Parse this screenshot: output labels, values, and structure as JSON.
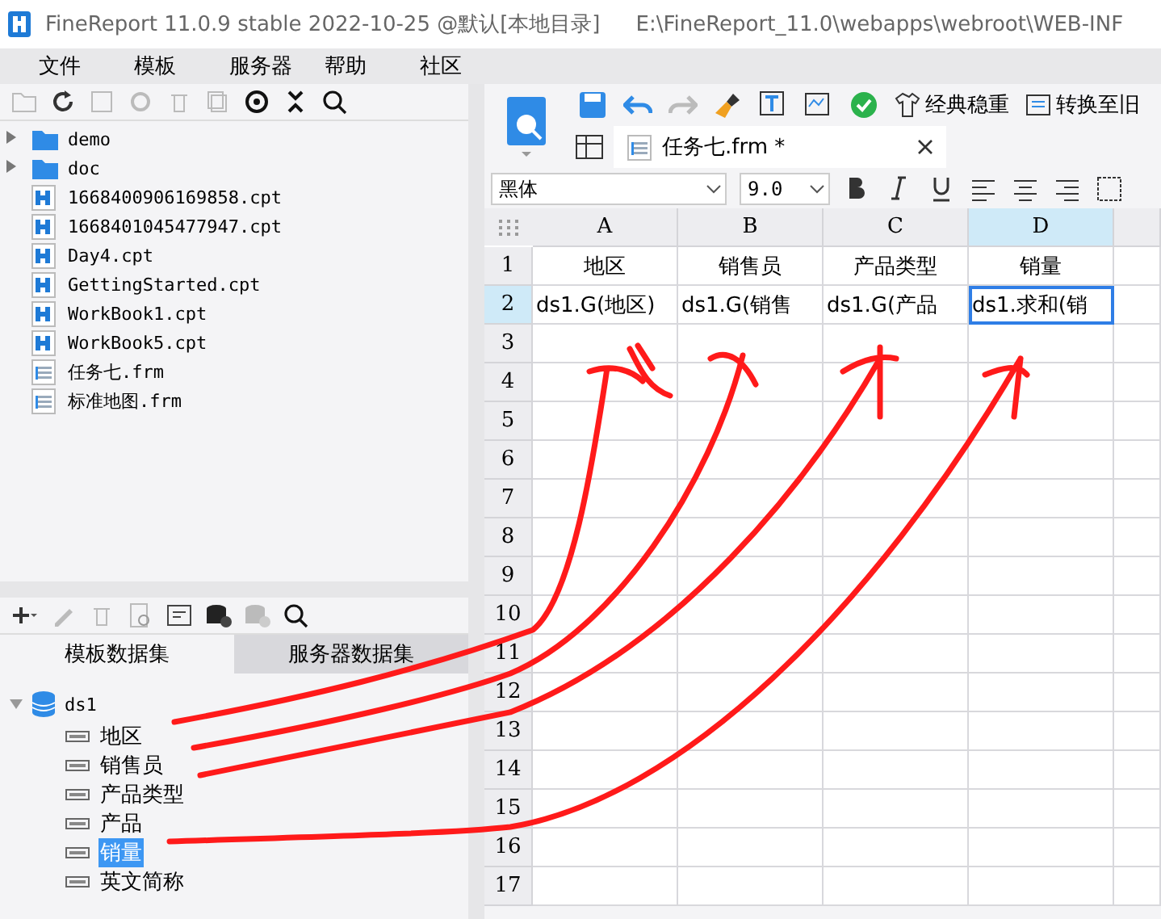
{
  "window": {
    "title": "FineReport 11.0.9 stable 2022-10-25 @默认[本地目录]",
    "path": "E:\\FineReport_11.0\\webapps\\webroot\\WEB-INF"
  },
  "menu": [
    "文件",
    "模板",
    "服务器",
    "帮助",
    "社区"
  ],
  "file_tree": [
    {
      "name": "demo",
      "kind": "folder"
    },
    {
      "name": "doc",
      "kind": "folder"
    },
    {
      "name": "1668400906169858.cpt",
      "kind": "cpt"
    },
    {
      "name": "1668401045477947.cpt",
      "kind": "cpt"
    },
    {
      "name": "Day4.cpt",
      "kind": "cpt"
    },
    {
      "name": "GettingStarted.cpt",
      "kind": "cpt"
    },
    {
      "name": "WorkBook1.cpt",
      "kind": "cpt"
    },
    {
      "name": "WorkBook5.cpt",
      "kind": "cpt"
    },
    {
      "name": "任务七.frm",
      "kind": "frm"
    },
    {
      "name": "标准地图.frm",
      "kind": "frm"
    }
  ],
  "dataset_tabs": [
    {
      "label": "模板数据集",
      "selected": true
    },
    {
      "label": "服务器数据集",
      "selected": false
    }
  ],
  "datasets": [
    {
      "name": "ds1",
      "expanded": true,
      "children": [
        {
          "name": "地区",
          "selected": false
        },
        {
          "name": "销售员",
          "selected": false
        },
        {
          "name": "产品类型",
          "selected": false
        },
        {
          "name": "产品",
          "selected": false
        },
        {
          "name": "销量",
          "selected": true
        },
        {
          "name": "英文简称",
          "selected": false
        }
      ]
    }
  ],
  "toolbar": {
    "theme_label": "经典稳重",
    "convert_label": "转换至旧"
  },
  "editor_tab": {
    "title": "任务七.frm *"
  },
  "format": {
    "font": "黑体",
    "size": "9.0"
  },
  "sheet": {
    "columns": [
      {
        "label": "A",
        "selected": false
      },
      {
        "label": "B",
        "selected": false
      },
      {
        "label": "C",
        "selected": false
      },
      {
        "label": "D",
        "selected": true
      }
    ],
    "rows": [
      {
        "label": "1",
        "selected": false,
        "cells": [
          {
            "text": "地区",
            "selected": false
          },
          {
            "text": "销售员",
            "selected": false
          },
          {
            "text": "产品类型",
            "selected": false
          },
          {
            "text": "销量",
            "selected": false
          }
        ]
      },
      {
        "label": "2",
        "selected": true,
        "cells": [
          {
            "text": "ds1.G(地区)",
            "selected": false
          },
          {
            "text": "ds1.G(销售",
            "selected": false
          },
          {
            "text": "ds1.G(产品",
            "selected": false
          },
          {
            "text": "ds1.求和(销",
            "selected": true
          }
        ]
      },
      {
        "label": "3",
        "selected": false
      },
      {
        "label": "4",
        "selected": false
      },
      {
        "label": "5",
        "selected": false
      },
      {
        "label": "6",
        "selected": false
      },
      {
        "label": "7",
        "selected": false
      },
      {
        "label": "8",
        "selected": false
      },
      {
        "label": "9",
        "selected": false
      },
      {
        "label": "10",
        "selected": false
      },
      {
        "label": "11",
        "selected": false
      },
      {
        "label": "12",
        "selected": false
      },
      {
        "label": "13",
        "selected": false
      },
      {
        "label": "14",
        "selected": false
      },
      {
        "label": "15",
        "selected": false
      },
      {
        "label": "16",
        "selected": false
      },
      {
        "label": "17",
        "selected": false
      }
    ]
  }
}
